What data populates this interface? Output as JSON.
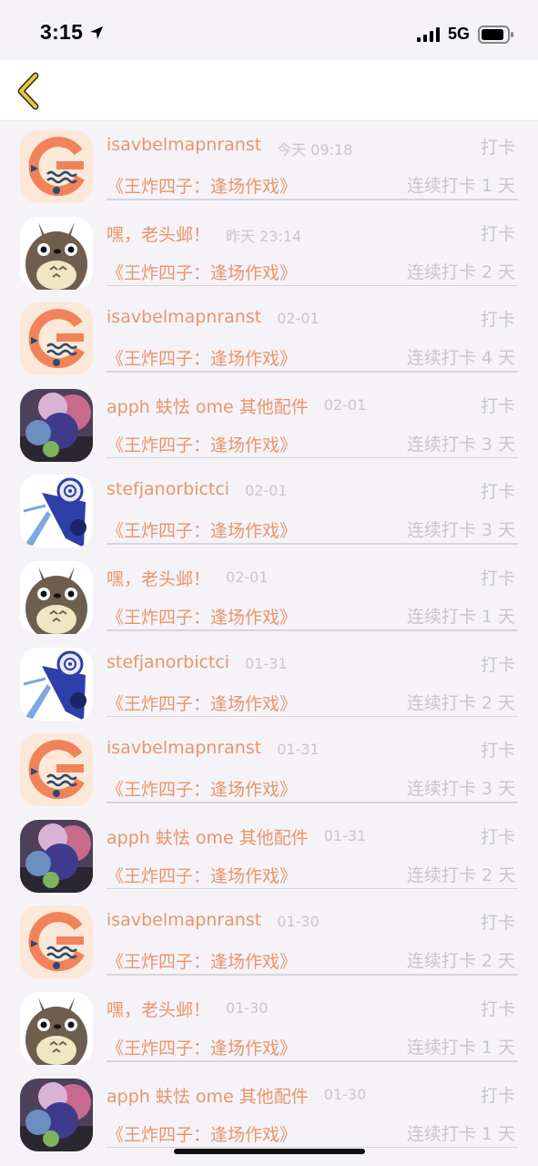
{
  "status_bar": {
    "time": "3:15",
    "network": "5G"
  },
  "nav": {
    "back_icon": "chevron-left-icon",
    "accent_color": "#e8c547"
  },
  "colors": {
    "name_color": "#e8956a",
    "muted_color": "#c8c6cb"
  },
  "entries": [
    {
      "avatar": "orange-g-logo",
      "name": "isavbelmapnranst",
      "time": "今天 09:18",
      "tag": "打卡",
      "book": "《王炸四子：逢场作戏》",
      "streak": "连续打卡 1 天"
    },
    {
      "avatar": "totoro",
      "name": "嘿，老头邺！",
      "time": "昨天 23:14",
      "tag": "打卡",
      "book": "《王炸四子：逢场作戏》",
      "streak": "连续打卡 2 天"
    },
    {
      "avatar": "orange-g-logo",
      "name": "isavbelmapnranst",
      "time": "02-01",
      "tag": "打卡",
      "book": "《王炸四子：逢场作戏》",
      "streak": "连续打卡 4 天"
    },
    {
      "avatar": "balloons",
      "name": "apph 蚨怯 ome 其他配件",
      "time": "02-01",
      "tag": "打卡",
      "book": "《王炸四子：逢场作戏》",
      "streak": "连续打卡 3 天"
    },
    {
      "avatar": "anime-blue",
      "name": "stefjanorbictci",
      "time": "02-01",
      "tag": "打卡",
      "book": "《王炸四子：逢场作戏》",
      "streak": "连续打卡 3 天"
    },
    {
      "avatar": "totoro",
      "name": "嘿，老头邺！",
      "time": "02-01",
      "tag": "打卡",
      "book": "《王炸四子：逢场作戏》",
      "streak": "连续打卡 1 天"
    },
    {
      "avatar": "anime-blue",
      "name": "stefjanorbictci",
      "time": "01-31",
      "tag": "打卡",
      "book": "《王炸四子：逢场作戏》",
      "streak": "连续打卡 2 天"
    },
    {
      "avatar": "orange-g-logo",
      "name": "isavbelmapnranst",
      "time": "01-31",
      "tag": "打卡",
      "book": "《王炸四子：逢场作戏》",
      "streak": "连续打卡 3 天"
    },
    {
      "avatar": "balloons",
      "name": "apph 蚨怯 ome 其他配件",
      "time": "01-31",
      "tag": "打卡",
      "book": "《王炸四子：逢场作戏》",
      "streak": "连续打卡 2 天"
    },
    {
      "avatar": "orange-g-logo",
      "name": "isavbelmapnranst",
      "time": "01-30",
      "tag": "打卡",
      "book": "《王炸四子：逢场作戏》",
      "streak": "连续打卡 2 天"
    },
    {
      "avatar": "totoro",
      "name": "嘿，老头邺！",
      "time": "01-30",
      "tag": "打卡",
      "book": "《王炸四子：逢场作戏》",
      "streak": "连续打卡 1 天"
    },
    {
      "avatar": "balloons",
      "name": "apph 蚨怯 ome 其他配件",
      "time": "01-30",
      "tag": "打卡",
      "book": "《王炸四子：逢场作戏》",
      "streak": "连续打卡 1 天"
    }
  ]
}
